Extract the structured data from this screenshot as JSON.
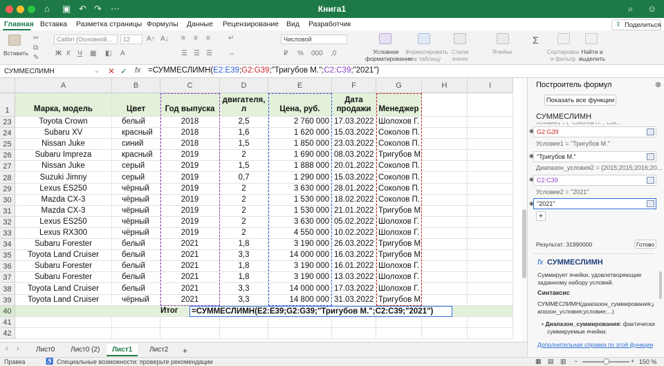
{
  "window": {
    "title": "Книга1"
  },
  "menu": {
    "tabs": [
      "Главная",
      "Вставка",
      "Разметка страницы",
      "Формулы",
      "Данные",
      "Рецензирование",
      "Вид",
      "Разработчик"
    ],
    "share": "Поделиться"
  },
  "ribbon": {
    "paste": "Вставить",
    "font_name": "Calibri (Основной...",
    "font_size": "12",
    "number_format": "Числовой",
    "conditional": "Условное форматирование",
    "format_table": "Форматировать как таблицу",
    "cell_styles": "Стили ячеек",
    "cells": "Ячейки",
    "sort": "Сортировка и фильтр",
    "find": "Найти и выделить"
  },
  "formula_bar": {
    "name_box": "СУММЕСЛИМН",
    "fx": "fx",
    "formula_prefix": "=СУММЕСЛИМН(",
    "ref1": "E2:E39",
    "sep1": ";",
    "ref2": "G2:G39",
    "mid": ";\"Тригубов М.\";",
    "ref3": "C2:C39",
    "suffix": ";\"2021\")"
  },
  "sheet": {
    "columns": [
      "A",
      "B",
      "C",
      "D",
      "E",
      "F",
      "G",
      "H",
      "I"
    ],
    "header_row": {
      "num": "1",
      "cells": [
        "Марка, модель",
        "Цвет",
        "Год выпуска",
        "Объём двигателя, л",
        "Цена, руб.",
        "Дата продажи",
        "Менеджер"
      ]
    },
    "rows": [
      {
        "num": "23",
        "model": "Toyota Crown",
        "color": "белый",
        "year": "2018",
        "engine": "2,5",
        "price": "2 760 000",
        "date": "17.03.2022",
        "manager": "Шолохов Г."
      },
      {
        "num": "24",
        "model": "Subaru XV",
        "color": "красный",
        "year": "2018",
        "engine": "1,6",
        "price": "1 620 000",
        "date": "15.03.2022",
        "manager": "Соколов П."
      },
      {
        "num": "25",
        "model": "Nissan Juke",
        "color": "синий",
        "year": "2018",
        "engine": "1,5",
        "price": "1 850 000",
        "date": "23.03.2022",
        "manager": "Соколов П."
      },
      {
        "num": "26",
        "model": "Subaru Impreza",
        "color": "красный",
        "year": "2019",
        "engine": "2",
        "price": "1 690 000",
        "date": "08.03.2022",
        "manager": "Тригубов М."
      },
      {
        "num": "27",
        "model": "Nissan Juke",
        "color": "серый",
        "year": "2019",
        "engine": "1,5",
        "price": "1 888 000",
        "date": "20.01.2022",
        "manager": "Соколов П."
      },
      {
        "num": "28",
        "model": "Suzuki Jimny",
        "color": "серый",
        "year": "2019",
        "engine": "0,7",
        "price": "1 290 000",
        "date": "15.03.2022",
        "manager": "Соколов П."
      },
      {
        "num": "29",
        "model": "Lexus ES250",
        "color": "чёрный",
        "year": "2019",
        "engine": "2",
        "price": "3 630 000",
        "date": "28.01.2022",
        "manager": "Соколов П."
      },
      {
        "num": "30",
        "model": "Mazda CX-3",
        "color": "чёрный",
        "year": "2019",
        "engine": "2",
        "price": "1 530 000",
        "date": "18.02.2022",
        "manager": "Соколов П."
      },
      {
        "num": "31",
        "model": "Mazda CX-3",
        "color": "чёрный",
        "year": "2019",
        "engine": "2",
        "price": "1 530 000",
        "date": "21.01.2022",
        "manager": "Тригубов М."
      },
      {
        "num": "32",
        "model": "Lexus ES250",
        "color": "чёрный",
        "year": "2019",
        "engine": "2",
        "price": "3 630 000",
        "date": "05.02.2022",
        "manager": "Шолохов Г."
      },
      {
        "num": "33",
        "model": "Lexus RX300",
        "color": "чёрный",
        "year": "2019",
        "engine": "2",
        "price": "4 550 000",
        "date": "10.02.2022",
        "manager": "Шолохов Г."
      },
      {
        "num": "34",
        "model": "Subaru Forester",
        "color": "белый",
        "year": "2021",
        "engine": "1,8",
        "price": "3 190 000",
        "date": "26.03.2022",
        "manager": "Тригубов М."
      },
      {
        "num": "35",
        "model": "Toyota Land Cruiser",
        "color": "белый",
        "year": "2021",
        "engine": "3,3",
        "price": "14 000 000",
        "date": "16.03.2022",
        "manager": "Тригубов М."
      },
      {
        "num": "36",
        "model": "Subaru Forester",
        "color": "белый",
        "year": "2021",
        "engine": "1,8",
        "price": "3 190 000",
        "date": "16.01.2022",
        "manager": "Шолохов Г."
      },
      {
        "num": "37",
        "model": "Subaru Forester",
        "color": "белый",
        "year": "2021",
        "engine": "1,8",
        "price": "3 190 000",
        "date": "13.03.2022",
        "manager": "Шолохов Г."
      },
      {
        "num": "38",
        "model": "Toyota Land Cruiser",
        "color": "белый",
        "year": "2021",
        "engine": "3,3",
        "price": "14 000 000",
        "date": "17.03.2022",
        "manager": "Шолохов Г."
      },
      {
        "num": "39",
        "model": "Toyota Land Cruiser",
        "color": "чёрный",
        "year": "2021",
        "engine": "3,3",
        "price": "14 800 000",
        "date": "31.03.2022",
        "manager": "Тригубов М."
      }
    ],
    "total_row": {
      "num": "40",
      "label": "Итог",
      "formula": "=СУММЕСЛИМН(E2:E39;G2:G39;\"Тригубов М.\";C2:C39;\"2021\")"
    },
    "extra_rows": [
      "41",
      "42"
    ]
  },
  "panel": {
    "title": "Построитель формул",
    "show_all": "Показать все функции",
    "func_name": "СУММЕСЛИМН",
    "cut_line": "Условие1 = { \"Соколов П.\";\"Сок...",
    "range1": "G2:G39",
    "cond1_label": "Условие1 = \"Тригубов М.\"",
    "cond1_value": "\"Тригубов М.\"",
    "range2_label": "Диапазон_условия2 = {2015;2015;2016;20...",
    "range2": "C2:C39",
    "cond2_label": "Условие2 = \"2021\"",
    "cond2_value": "\"2021\"",
    "plus": "+",
    "result": "Результат: 31990000",
    "done": "Готово",
    "desc_title": "СУММЕСЛИМН",
    "desc": "Суммирует ячейки, удовлетворяющие заданному набору условий.",
    "syntax_title": "Синтаксис",
    "syntax_line1": "СУММЕСЛИМН(диапазон_суммирования;ди",
    "syntax_line2": "апазон_условия;условие;...)",
    "bullet_bold": "Диапазон_суммирования",
    "bullet_rest": ": фактически",
    "bullet_line2": "суммируемые ячейки.",
    "more_help": "Дополнительная справка по этой функции"
  },
  "tabs": {
    "items": [
      "Лист0",
      "Лист0 (2)",
      "Лист1",
      "Лист2"
    ],
    "active": "Лист1",
    "add": "+"
  },
  "status": {
    "edit": "Правка",
    "accessibility": "Специальные возможности: проверьте рекомендации",
    "zoom": "150 %"
  },
  "colors": {
    "excel_green": "#1d7a46",
    "header_fill": "#e3f1da",
    "ref_blue": "#2f5bd3",
    "ref_purple": "#8a3ebf",
    "ref_red": "#c62828"
  }
}
